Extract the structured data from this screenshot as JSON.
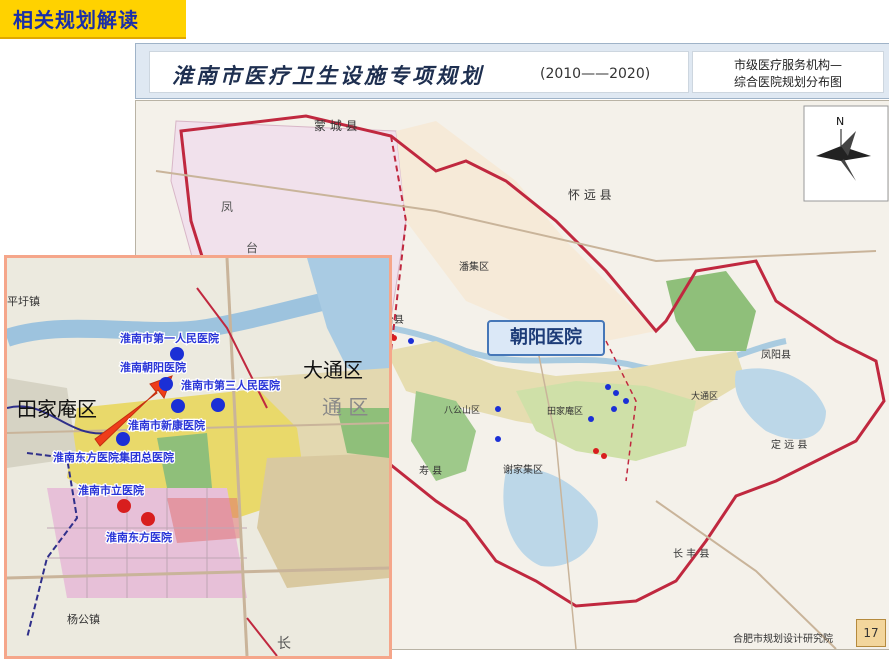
{
  "tag": {
    "label": "相关规划解读"
  },
  "title": {
    "main": "淮南市医疗卫生设施专项规划",
    "years": "(2010——2020)",
    "side_line1": "市级医疗服务机构—",
    "side_line2": "综合医院规划分布图"
  },
  "compass": {
    "label": "N"
  },
  "footer": {
    "institute": "合肥市规划设计研究院",
    "page": "17"
  },
  "callout": {
    "label": "朝阳医院"
  },
  "map_labels": {
    "mengcheng": "蒙 城 县",
    "huaiyuan": "怀 远 县",
    "fengtai1": "凤",
    "fengtai2": "台",
    "panji": "潘集区",
    "fengyang": "凤阳县",
    "dingyuan": "定 远 县",
    "changfeng": "长 丰 县",
    "shouxian": "寿 县",
    "xiejiaji": "谢家集区",
    "bagongshan": "八公山区",
    "tianjiaan": "田家庵区",
    "datong": "大通区",
    "fengtaixian": "凤台县"
  },
  "inset_labels": {
    "pingxu": "平圩镇",
    "datong": "大通区",
    "tongqu": "通 区",
    "tianjiaan": "田家庵区",
    "yanggong": "杨公镇",
    "chang": "长"
  },
  "hospitals": [
    {
      "name": "淮南市第一人民医院",
      "color": "#1b2fd6"
    },
    {
      "name": "淮南朝阳医院",
      "color": "#1b2fd6"
    },
    {
      "name": "淮南市第三人民医院",
      "color": "#1b2fd6"
    },
    {
      "name": "淮南市新康医院",
      "color": "#1b2fd6"
    },
    {
      "name": "淮南东方医院集团总医院",
      "color": "#1b2fd6"
    },
    {
      "name": "淮南市立医院",
      "color": "#d81e1e"
    },
    {
      "name": "淮南东方医院",
      "color": "#d81e1e"
    }
  ],
  "colors": {
    "tag": "#ffd200",
    "boundary": "#c0283f",
    "arrow": "#ef3d1a",
    "inset_border": "#f5a68a"
  }
}
